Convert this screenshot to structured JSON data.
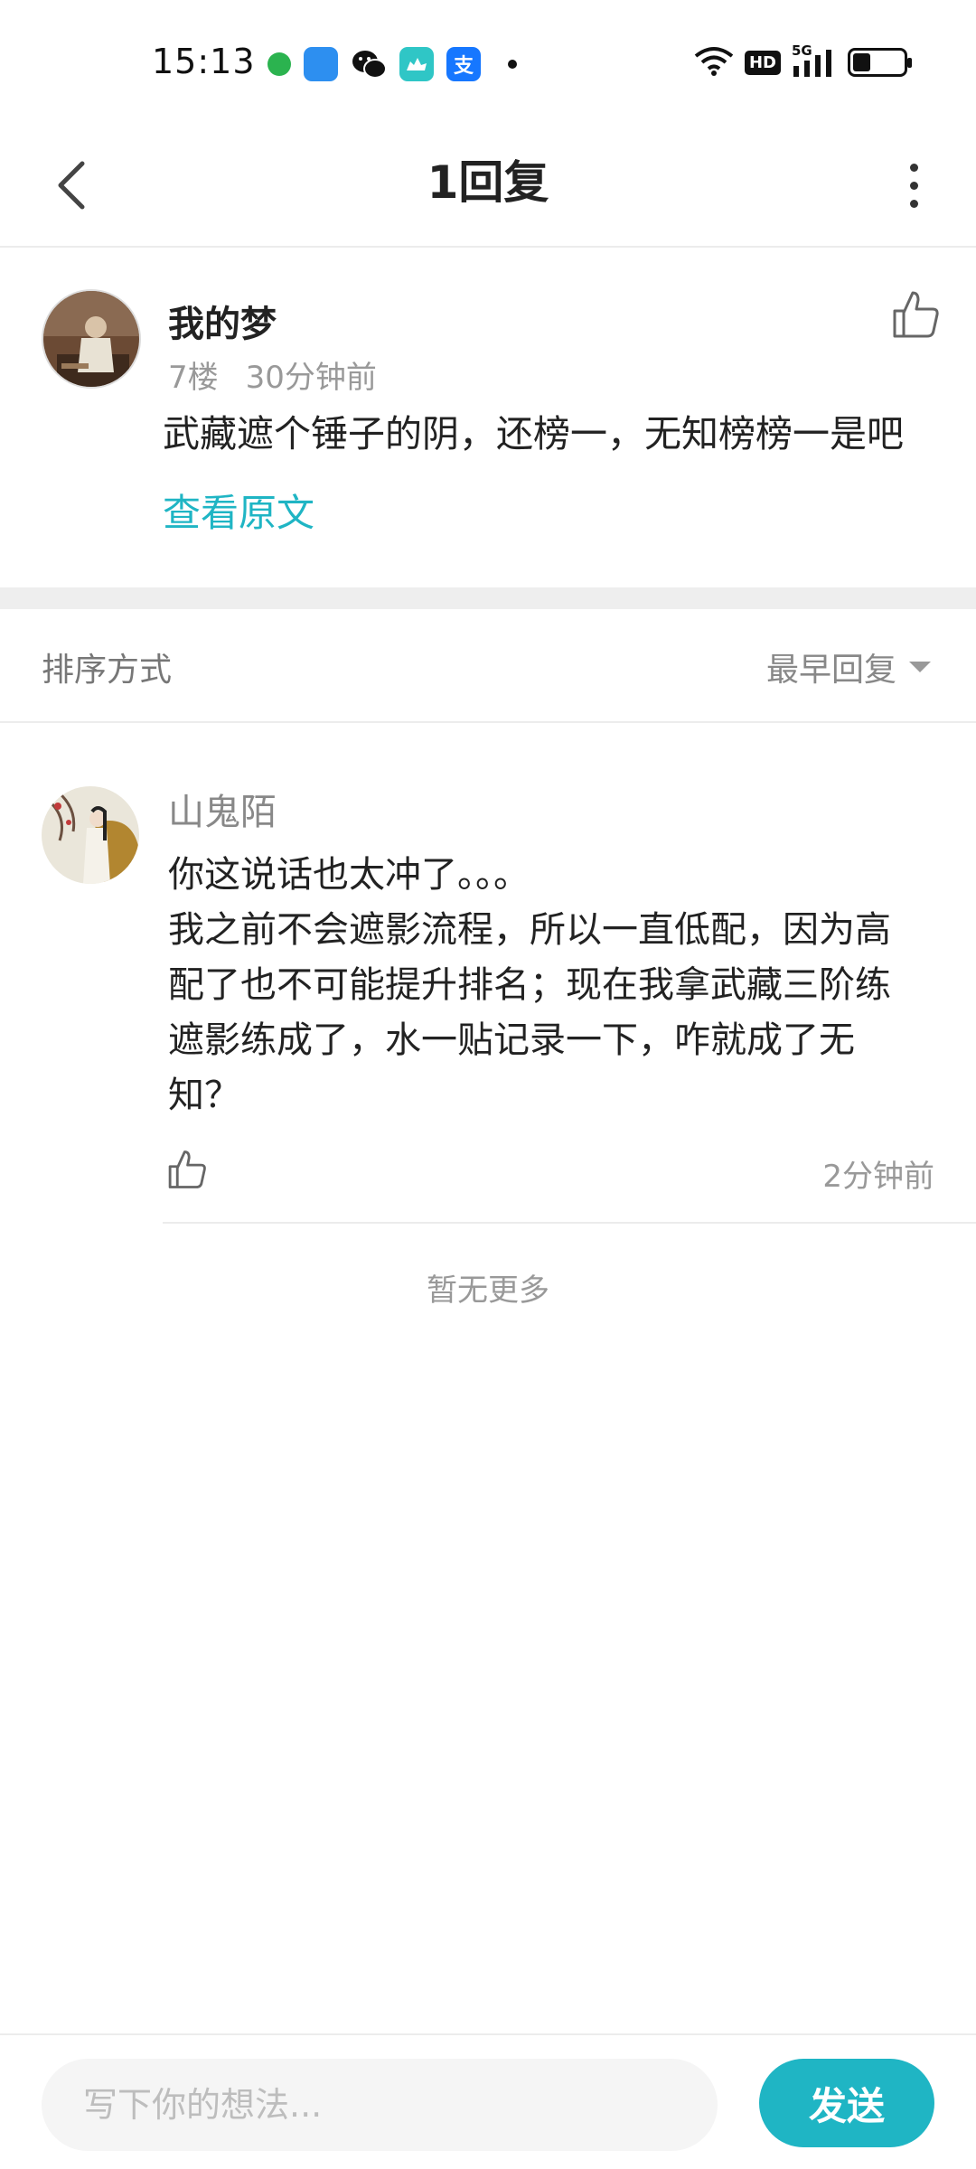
{
  "status_bar": {
    "time": "15:13",
    "app_icons": [
      "green-dot-icon",
      "blue-square-icon",
      "wechat-icon",
      "camel-app-icon",
      "alipay-icon"
    ],
    "alipay_char": "支",
    "hd_label": "HD",
    "network_label": "5G",
    "battery_level": 0.35
  },
  "header": {
    "title": "1回复"
  },
  "main_comment": {
    "username": "我的梦",
    "floor": "7楼",
    "time": "30分钟前",
    "text": "武藏遮个锤子的阴，还榜一，无知榜榜一是吧",
    "view_original": "查看原文"
  },
  "sort": {
    "label": "排序方式",
    "value": "最早回复"
  },
  "reply": {
    "username": "山鬼陌",
    "lines": [
      "你这说话也太冲了。。。",
      "我之前不会遮影流程，所以一直低配，因为高",
      "配了也不可能提升排名；现在我拿武藏三阶练",
      "遮影练成了，水一贴记录一下，咋就成了无",
      "知？"
    ],
    "time": "2分钟前"
  },
  "footer_note": "暂无更多",
  "input_bar": {
    "placeholder": "写下你的想法...",
    "send_label": "发送"
  },
  "colors": {
    "accent": "#1fb5c4",
    "text_primary": "#222222",
    "text_secondary": "#999999"
  }
}
